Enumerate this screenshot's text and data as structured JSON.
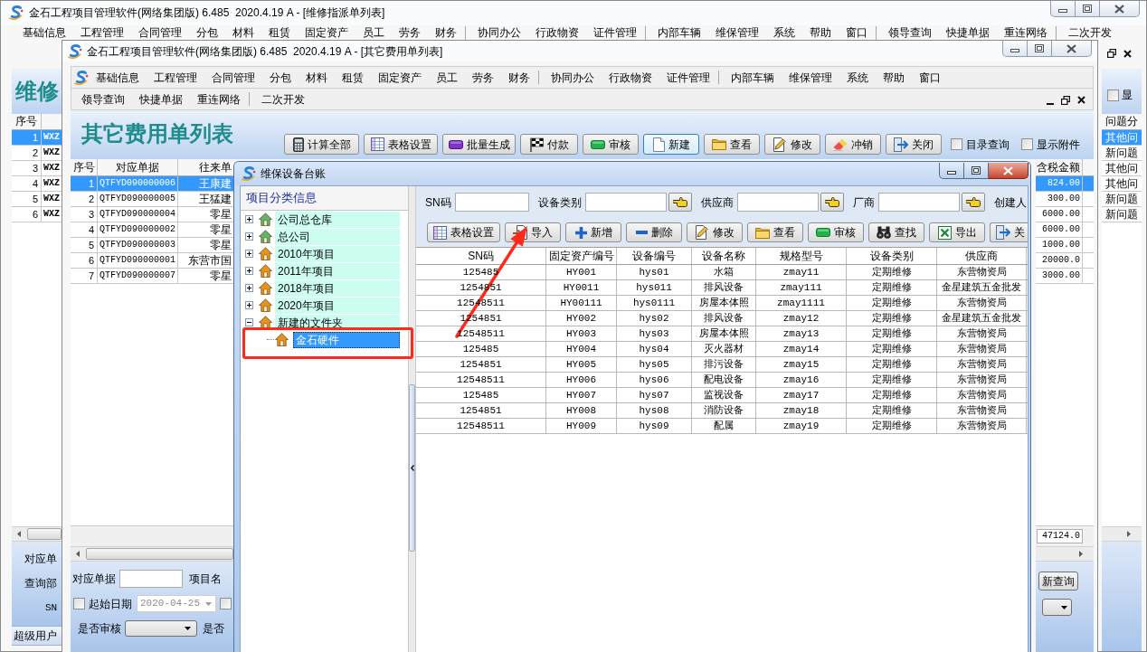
{
  "back_window": {
    "active": false,
    "title": "金石工程项目管理软件(网络集团版) 6.485  2020.4.19 A - [维修指派单列表]",
    "menu_groups": [
      [
        "基础信息",
        "工程管理",
        "合同管理",
        "分包",
        "材料",
        "租赁",
        "固定资产",
        "员工",
        "劳务",
        "财务"
      ],
      [
        "协同办公",
        "行政物资",
        "证件管理"
      ],
      [
        "内部车辆",
        "维保管理",
        "系统",
        "帮助",
        "窗口"
      ],
      [
        "领导查询",
        "快捷单据",
        "重连网络"
      ],
      [
        "二次开发"
      ]
    ],
    "heading": "维修",
    "option": {
      "label": "显",
      "checked": false
    },
    "table": {
      "columns": [
        "序号",
        "问题分"
      ],
      "rows": [
        {
          "no": "1",
          "column_2": "WXZ",
          "column_3": "其他问",
          "selected": true
        },
        {
          "no": "2",
          "column_2": "WXZ",
          "column_3": "新问题",
          "selected": false
        },
        {
          "no": "3",
          "column_2": "WXZ",
          "column_3": "其他问",
          "selected": false
        },
        {
          "no": "4",
          "column_2": "WXZ",
          "column_3": "其他问",
          "selected": false
        },
        {
          "no": "5",
          "column_2": "WXZ",
          "column_3": "新问题",
          "selected": false
        },
        {
          "no": "6",
          "column_2": "WXZ",
          "column_3": "新问题",
          "selected": false
        }
      ]
    },
    "search_labels": [
      "对应单",
      "查询部",
      "SN"
    ],
    "status_bar": "超级用户"
  },
  "main_window": {
    "active": false,
    "title": "金石工程项目管理软件(网络集团版) 6.485  2020.4.19 A - [其它费用单列表]",
    "menu_groups": [
      [
        "基础信息",
        "工程管理",
        "合同管理",
        "分包",
        "材料",
        "租赁",
        "固定资产",
        "员工",
        "劳务",
        "财务"
      ],
      [
        "协同办公",
        "行政物资",
        "证件管理"
      ],
      [
        "内部车辆",
        "维保管理",
        "系统",
        "帮助",
        "窗口"
      ]
    ],
    "menu_row_2": [
      [
        "领导查询",
        "快捷单据",
        "重连网络"
      ],
      [
        "二次开发"
      ]
    ],
    "heading": "其它费用单列表",
    "toolbar": [
      {
        "label": "计算全部",
        "focused": false
      },
      {
        "label": "表格设置",
        "focused": false
      },
      {
        "label": "批量生成",
        "focused": false
      },
      {
        "label": "付款",
        "focused": false
      },
      {
        "label": "审核",
        "focused": false
      },
      {
        "label": "新建",
        "focused": true
      },
      {
        "label": "查看",
        "focused": false
      },
      {
        "label": "修改",
        "focused": false
      },
      {
        "label": "冲销",
        "focused": false
      },
      {
        "label": "关闭",
        "focused": false
      }
    ],
    "options": [
      {
        "label": "目录查询",
        "checked": false
      },
      {
        "label": "显示附件",
        "checked": false
      }
    ],
    "table": {
      "columns": [
        "序号",
        "对应单据",
        "往来单",
        "含税金额"
      ],
      "rows": [
        {
          "no": "1",
          "document": "QTFYD090000006",
          "column_3": "王康建",
          "amount": "824.00",
          "selected": true
        },
        {
          "no": "2",
          "document": "QTFYD090000005",
          "column_3": "王猛建",
          "amount": "300.00",
          "selected": false
        },
        {
          "no": "3",
          "document": "QTFYD090000004",
          "column_3": "零星",
          "amount": "6000.00",
          "selected": false
        },
        {
          "no": "4",
          "document": "QTFYD090000002",
          "column_3": "零星",
          "amount": "6000.00",
          "selected": false
        },
        {
          "no": "5",
          "document": "QTFYD090000003",
          "column_3": "零星",
          "amount": "1000.00",
          "selected": false
        },
        {
          "no": "6",
          "document": "QTFYD090000001",
          "column_3": "东营市国",
          "amount": "20000.0",
          "selected": false
        },
        {
          "no": "7",
          "document": "QTFYD090000007",
          "column_3": "零星",
          "amount": "3000.00",
          "selected": false
        }
      ],
      "total": "47124.0"
    },
    "query_panel": {
      "document_label": "对应单据",
      "project_label": "项目名",
      "start_date": {
        "label": "起始日期",
        "checked": false,
        "value": "2020-04-25",
        "disabled": true
      },
      "checkbox_2": {
        "checked": false
      },
      "audited_label": "是否审核",
      "column_label": "是否"
    },
    "refresh_button": "新查询"
  },
  "dialog": {
    "active": true,
    "title": "维保设备台账",
    "tree": {
      "heading": "项目分类信息",
      "items": [
        {
          "label": "公司总仓库",
          "color": "#5fb56f",
          "expanded": false,
          "selected": false
        },
        {
          "label": "总公司",
          "color": "#5fb56f",
          "expanded": false,
          "selected": false
        },
        {
          "label": "2010年项目",
          "color": "#e8921e",
          "expanded": false,
          "selected": false
        },
        {
          "label": "2011年项目",
          "color": "#e8921e",
          "expanded": false,
          "selected": false
        },
        {
          "label": "2018年项目",
          "color": "#e8921e",
          "expanded": false,
          "selected": false
        },
        {
          "label": "2020年项目",
          "color": "#e8921e",
          "expanded": false,
          "selected": false
        },
        {
          "label": "新建的文件夹",
          "color": "#e8921e",
          "expanded": true,
          "selected": false,
          "children": [
            {
              "label": "金石硬件",
              "color": "#e8921e",
              "selected": true
            }
          ]
        }
      ]
    },
    "filters": [
      {
        "label": "SN码",
        "lookup": false
      },
      {
        "label": "设备类别",
        "lookup": true
      },
      {
        "label": "供应商",
        "lookup": true
      },
      {
        "label": "厂商",
        "lookup": true
      }
    ],
    "filter_label_end": "创建人",
    "toolbar": [
      "表格设置",
      "导入",
      "新增",
      "删除",
      "修改",
      "查看",
      "审核",
      "查找",
      "导出",
      "关"
    ],
    "table": {
      "columns": [
        "SN码",
        "固定资产编号",
        "设备编号",
        "设备名称",
        "规格型号",
        "设备类别",
        "供应商"
      ],
      "rows": [
        [
          "125485",
          "HY001",
          "hys01",
          "水箱",
          "zmay11",
          "定期维修",
          "东营物资局"
        ],
        [
          "1254851",
          "HY0011",
          "hys011",
          "排风设备",
          "zmay111",
          "定期维修",
          "金星建筑五金批发"
        ],
        [
          "12548511",
          "HY00111",
          "hys0111",
          "房屋本体照",
          "zmay1111",
          "定期维修",
          "东营物资局"
        ],
        [
          "1254851",
          "HY002",
          "hys02",
          "排风设备",
          "zmay12",
          "定期维修",
          "金星建筑五金批发"
        ],
        [
          "12548511",
          "HY003",
          "hys03",
          "房屋本体照",
          "zmay13",
          "定期维修",
          "东营物资局"
        ],
        [
          "125485",
          "HY004",
          "hys04",
          "灭火器材",
          "zmay14",
          "定期维修",
          "东营物资局"
        ],
        [
          "1254851",
          "HY005",
          "hys05",
          "排污设备",
          "zmay15",
          "定期维修",
          "东营物资局"
        ],
        [
          "12548511",
          "HY006",
          "hys06",
          "配电设备",
          "zmay16",
          "定期维修",
          "东营物资局"
        ],
        [
          "125485",
          "HY007",
          "hys07",
          "监视设备",
          "zmay17",
          "定期维修",
          "东营物资局"
        ],
        [
          "1254851",
          "HY008",
          "hys08",
          "消防设备",
          "zmay18",
          "定期维修",
          "东营物资局"
        ],
        [
          "12548511",
          "HY009",
          "hys09",
          "配属",
          "zmay19",
          "定期维修",
          "东营物资局"
        ]
      ]
    }
  }
}
